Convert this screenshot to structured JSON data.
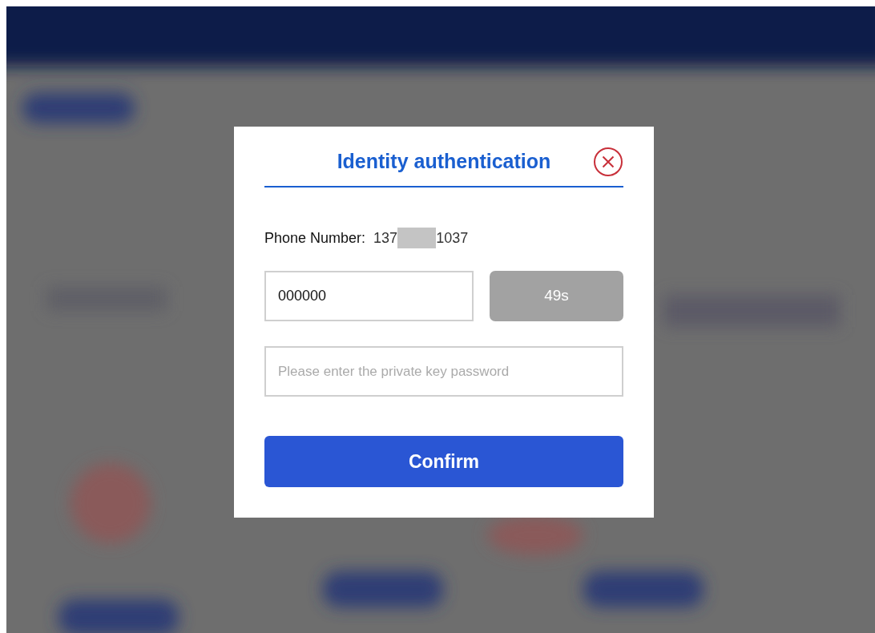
{
  "dialog": {
    "title": "Identity authentication",
    "phone": {
      "label": "Phone Number:",
      "prefix": "137",
      "masked": true,
      "suffix": "1037"
    },
    "code_field": {
      "value": "000000"
    },
    "countdown_button": {
      "label": "49s",
      "disabled": true
    },
    "password_field": {
      "placeholder": "Please enter the private key password"
    },
    "confirm_button": {
      "label": "Confirm"
    }
  }
}
